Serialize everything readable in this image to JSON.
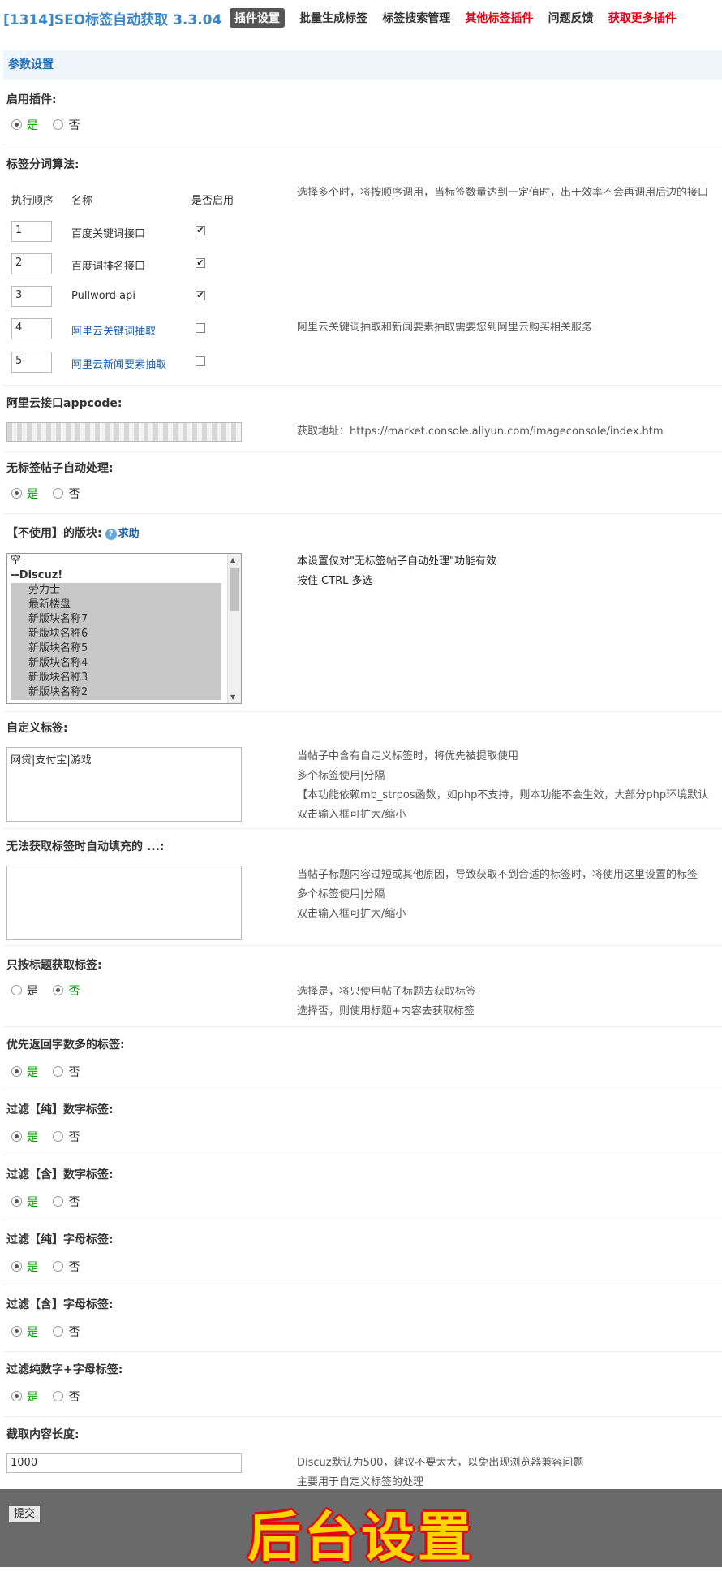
{
  "header": {
    "title": "[1314]SEO标签自动获取 3.3.04",
    "nav": [
      {
        "label": "插件设置",
        "state": "active"
      },
      {
        "label": "批量生成标签",
        "state": "normal"
      },
      {
        "label": "标签搜索管理",
        "state": "normal"
      },
      {
        "label": "其他标签插件",
        "state": "red"
      },
      {
        "label": "问题反馈",
        "state": "normal"
      },
      {
        "label": "获取更多插件",
        "state": "red"
      }
    ]
  },
  "section_title": "参数设置",
  "radio_yes": "是",
  "radio_no": "否",
  "enable_plugin": {
    "label": "启用插件:",
    "value": "是"
  },
  "algorithm": {
    "label": "标签分词算法:",
    "col_order": "执行顺序",
    "col_name": "名称",
    "col_enabled": "是否启用",
    "hint": "选择多个时，将按顺序调用，当标签数量达到一定值时，出于效率不会再调用后边的接口",
    "aliyun_hint": "阿里云关键词抽取和新闻要素抽取需要您到阿里云购买相关服务",
    "rows": [
      {
        "order": "1",
        "name": "百度关键词接口",
        "enabled": true,
        "link": false
      },
      {
        "order": "2",
        "name": "百度词排名接口",
        "enabled": true,
        "link": false
      },
      {
        "order": "3",
        "name": "Pullword api",
        "enabled": true,
        "link": false
      },
      {
        "order": "4",
        "name": "阿里云关键词抽取",
        "enabled": false,
        "link": true
      },
      {
        "order": "5",
        "name": "阿里云新闻要素抽取",
        "enabled": false,
        "link": true
      }
    ]
  },
  "appcode": {
    "label": "阿里云接口appcode:",
    "hint": "获取地址：https://market.console.aliyun.com/imageconsole/index.htm"
  },
  "no_tag_auto": {
    "label": "无标签帖子自动处理:",
    "value": "是"
  },
  "unused_forums": {
    "label": "【不使用】的版块:",
    "help": "求助",
    "hint1": "本设置仅对\"无标签帖子自动处理\"功能有效",
    "hint2": "按住 CTRL 多选",
    "options": [
      {
        "text": "空",
        "kind": "plain"
      },
      {
        "text": "--Discuz!",
        "kind": "group"
      },
      {
        "text": "劳力士",
        "kind": "sel"
      },
      {
        "text": "最新楼盘",
        "kind": "sel"
      },
      {
        "text": "新版块名称7",
        "kind": "sel"
      },
      {
        "text": "新版块名称6",
        "kind": "sel"
      },
      {
        "text": "新版块名称5",
        "kind": "sel"
      },
      {
        "text": "新版块名称4",
        "kind": "sel"
      },
      {
        "text": "新版块名称3",
        "kind": "sel"
      },
      {
        "text": "新版块名称2",
        "kind": "sel"
      }
    ]
  },
  "custom_tags": {
    "label": "自定义标签:",
    "value": "网贷|支付宝|游戏",
    "hint": [
      "当帖子中含有自定义标签时，将优先被提取使用",
      "多个标签使用|分隔",
      "【本功能依赖mb_strpos函数，如php不支持，则本功能不会生效，大部分php环境默认",
      "双击输入框可扩大/缩小"
    ]
  },
  "fallback_tags": {
    "label": "无法获取标签时自动填充的 ...:",
    "value": "",
    "hint": [
      "当帖子标题内容过短或其他原因，导致获取不到合适的标签时，将使用这里设置的标签",
      "多个标签使用|分隔",
      "双击输入框可扩大/缩小"
    ]
  },
  "title_only": {
    "label": "只按标题获取标签:",
    "value": "否",
    "hint": [
      "选择是，将只使用帖子标题去获取标签",
      "选择否，则使用标题+内容去获取标签"
    ]
  },
  "prefer_long": {
    "label": "优先返回字数多的标签:",
    "value": "是"
  },
  "filter_pure_num": {
    "label": "过滤【纯】数字标签:",
    "value": "是"
  },
  "filter_has_num": {
    "label": "过滤【含】数字标签:",
    "value": "是"
  },
  "filter_pure_alpha": {
    "label": "过滤【纯】字母标签:",
    "value": "是"
  },
  "filter_has_alpha": {
    "label": "过滤【含】字母标签:",
    "value": "是"
  },
  "filter_alnum": {
    "label": "过滤纯数字+字母标签:",
    "value": "是"
  },
  "content_length": {
    "label": "截取内容长度:",
    "value": "1000",
    "hint": [
      "Discuz默认为500，建议不要太大，以免出现浏览器兼容问题",
      "主要用于自定义标签的处理"
    ]
  },
  "submit": "提交",
  "banner": "后台设置"
}
